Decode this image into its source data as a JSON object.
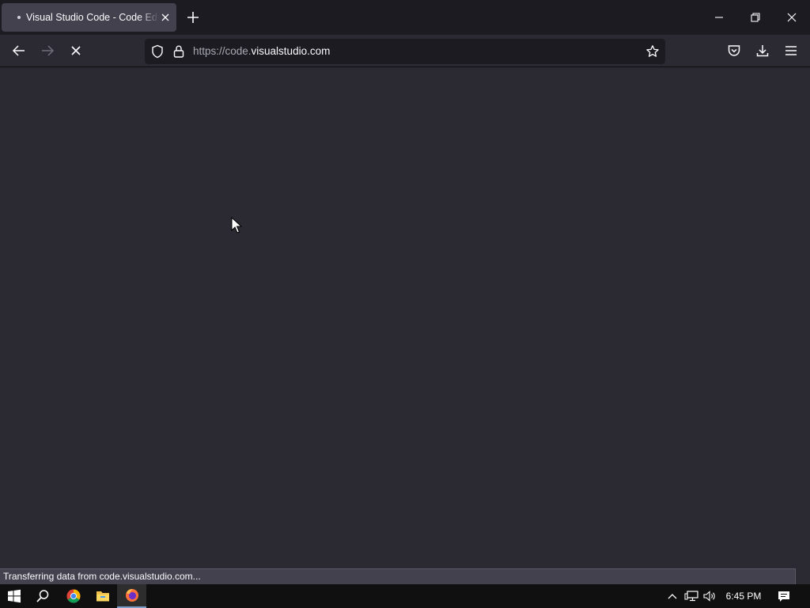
{
  "browser": {
    "tab": {
      "title": "Visual Studio Code - Code Editing. Redefined",
      "loading": true
    },
    "url": {
      "scheme_prefix": "https://code.",
      "host": "visualstudio.com"
    },
    "status_text": "Transferring data from code.visualstudio.com...",
    "icons": {
      "back": "arrow-left-icon",
      "forward": "arrow-right-icon",
      "stop": "close-icon",
      "tracking": "shield-icon",
      "lock": "lock-icon",
      "bookmark": "star-icon",
      "pocket": "pocket-icon",
      "downloads": "download-icon",
      "menu": "hamburger-menu-icon",
      "new_tab": "plus-icon",
      "minimize": "minimize-icon",
      "restore": "restore-icon",
      "close": "close-icon"
    }
  },
  "taskbar": {
    "time": "6:45 PM",
    "apps": [
      "start-icon",
      "search-icon",
      "chrome-icon",
      "file-explorer-icon",
      "firefox-icon"
    ],
    "tray": [
      "chevron-up-icon",
      "network-icon",
      "volume-icon",
      "notification-icon"
    ]
  },
  "colors": {
    "background": "#2b2a33",
    "tabstrip": "#1c1b22",
    "active_tab": "#42414d",
    "taskbar": "#101010"
  }
}
